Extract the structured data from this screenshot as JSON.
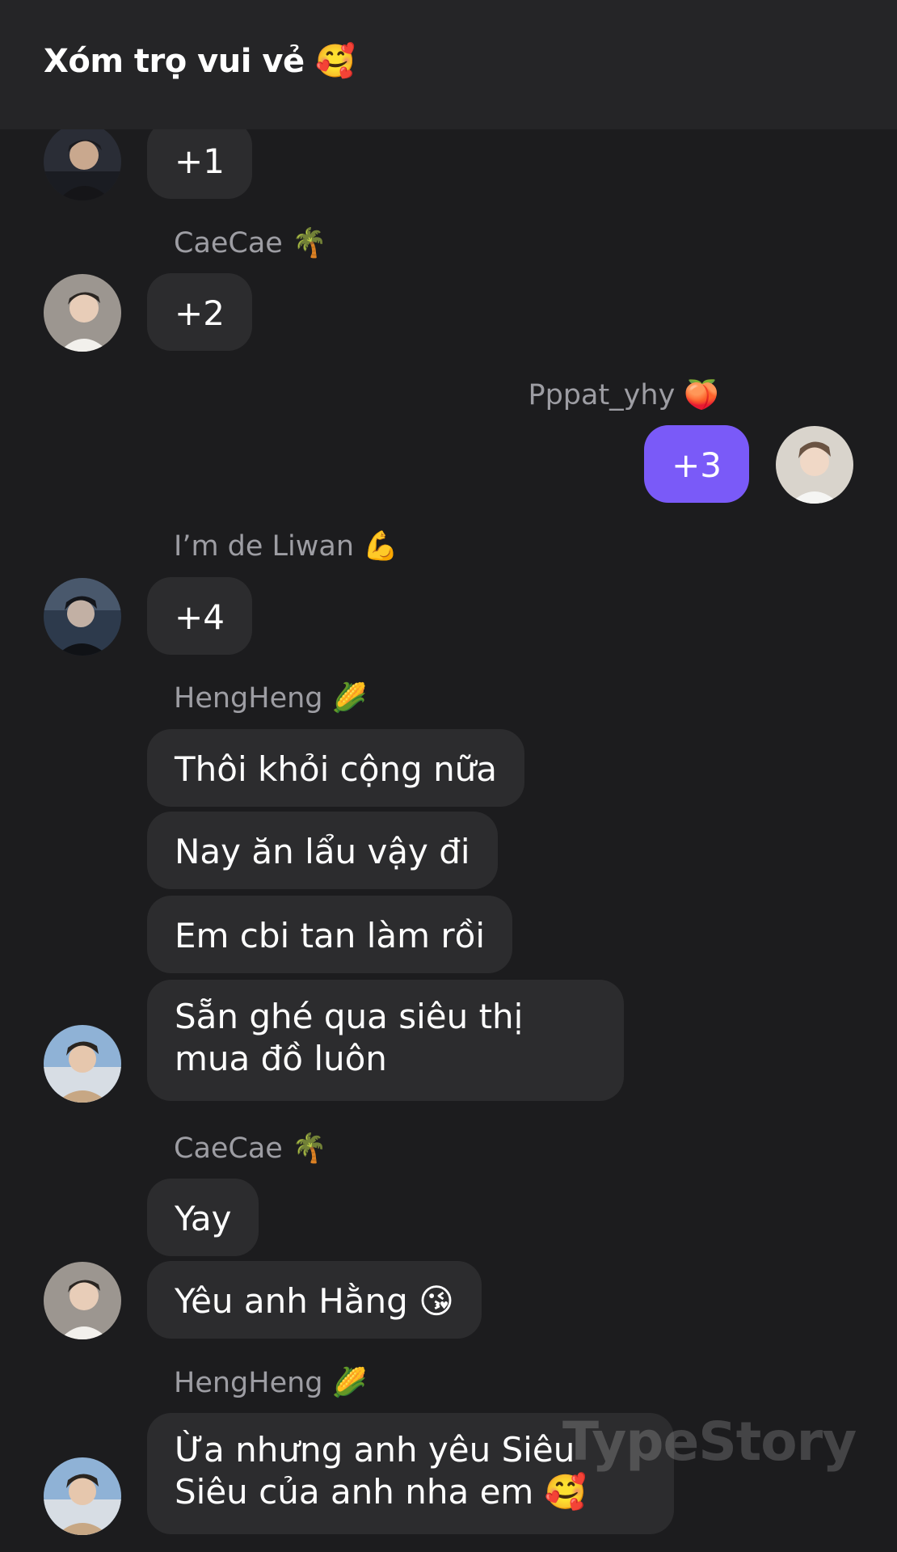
{
  "header": {
    "title": "Xóm trọ vui vẻ 🥰"
  },
  "messages": [
    {
      "sender": "",
      "text": "+1"
    },
    {
      "sender": "CaeCae 🌴",
      "text": "+2"
    },
    {
      "sender": "Pppat_yhy 🍑",
      "text": "+3",
      "mine": true
    },
    {
      "sender": "I’m de Liwan 💪",
      "text": "+4"
    },
    {
      "sender": "HengHeng 🌽",
      "texts": [
        "Thôi khỏi cộng nữa",
        "Nay ăn lẩu vậy đi",
        "Em cbi tan làm rồi",
        "Sẵn ghé qua siêu thị mua đồ luôn"
      ]
    },
    {
      "sender": "CaeCae 🌴",
      "texts": [
        "Yay",
        "Yêu anh Hằng 😘"
      ]
    },
    {
      "sender": "HengHeng 🌽",
      "texts": [
        "Ừa nhưng anh yêu Siêu Siêu của anh nha em 🥰"
      ]
    }
  ],
  "watermark": "TypeStory",
  "colors": {
    "background": "#1c1c1e",
    "header": "#252527",
    "bubble": "#2c2c2e",
    "bubble_mine": "#7a5af8",
    "sender_text": "#9d9da3"
  }
}
